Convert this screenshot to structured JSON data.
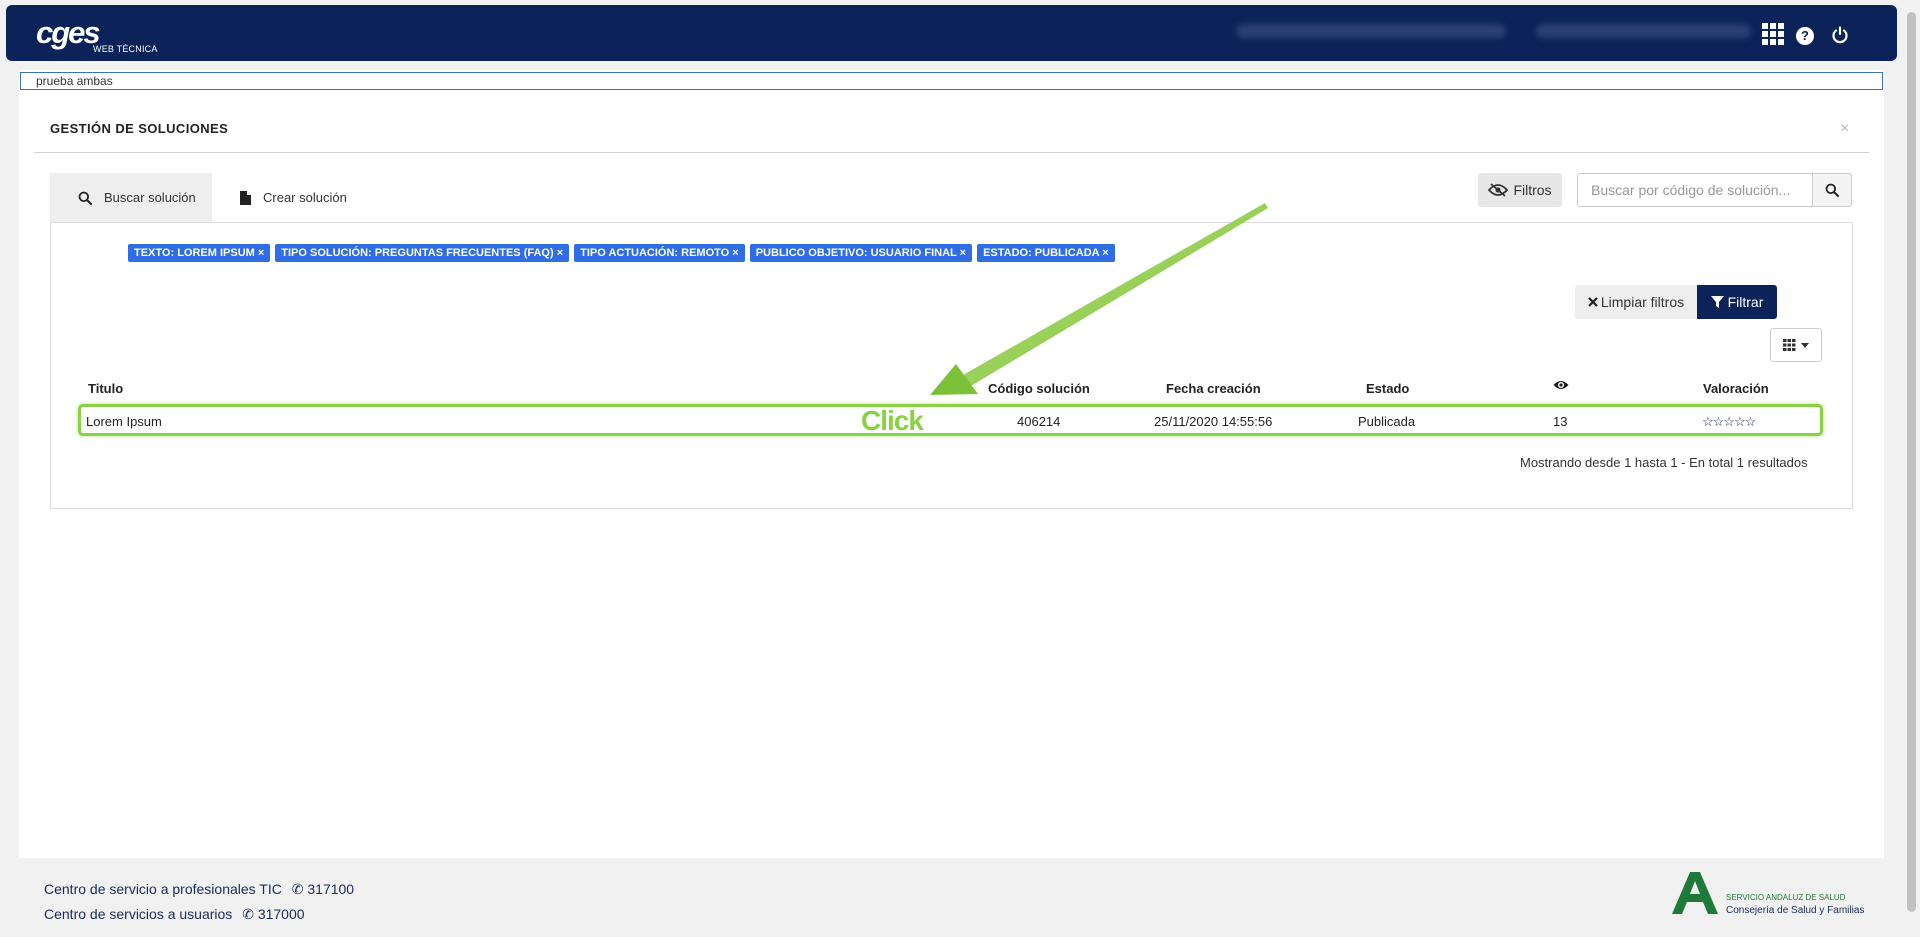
{
  "header": {
    "logo_main": "cges",
    "logo_sub": "WEB TÉCNICA"
  },
  "breadcrumb": "prueba ambas",
  "panel": {
    "title": "GESTIÓN DE SOLUCIONES",
    "close": "×"
  },
  "tabs": [
    {
      "label": "Buscar solución",
      "icon": "search-icon",
      "active": true
    },
    {
      "label": "Crear solución",
      "icon": "file-icon",
      "active": false
    }
  ],
  "toolbar": {
    "filtros_label": "Filtros",
    "search_placeholder": "Buscar por código de solución..."
  },
  "chips": [
    "TEXTO: LOREM IPSUM ×",
    "TIPO SOLUCIÓN: PREGUNTAS FRECUENTES (FAQ) ×",
    "TIPO ACTUACIÓN: REMOTO ×",
    "PUBLICO OBJETIVO: USUARIO FINAL ×",
    "ESTADO: PUBLICADA ×"
  ],
  "filter_actions": {
    "clear_label": "Limpiar filtros",
    "filter_label": "Filtrar"
  },
  "table": {
    "headers": {
      "titulo": "Titulo",
      "codigo": "Código solución",
      "fecha": "Fecha creación",
      "estado": "Estado",
      "views": "eye-icon",
      "valoracion": "Valoración"
    },
    "rows": [
      {
        "titulo": "Lorem Ipsum",
        "codigo": "406214",
        "fecha": "25/11/2020 14:55:56",
        "estado": "Publicada",
        "views": "13",
        "valoracion": "☆☆☆☆☆"
      }
    ],
    "result_text": "Mostrando desde 1 hasta 1 - En total 1 resultados"
  },
  "annotation": {
    "label": "Click",
    "color": "#8ad144"
  },
  "footer": {
    "line1_text": "Centro de servicio a profesionales TIC",
    "line1_phone": "317100",
    "line2_text": "Centro de servicios a usuarios",
    "line2_phone": "317000",
    "org_name": "SERVICIO ANDALUZ DE SALUD",
    "org_dept": "Consejería de Salud y Familias"
  },
  "colors": {
    "navbar": "#0b2359",
    "chip": "#2e6de6",
    "accent_green": "#8ad144"
  }
}
